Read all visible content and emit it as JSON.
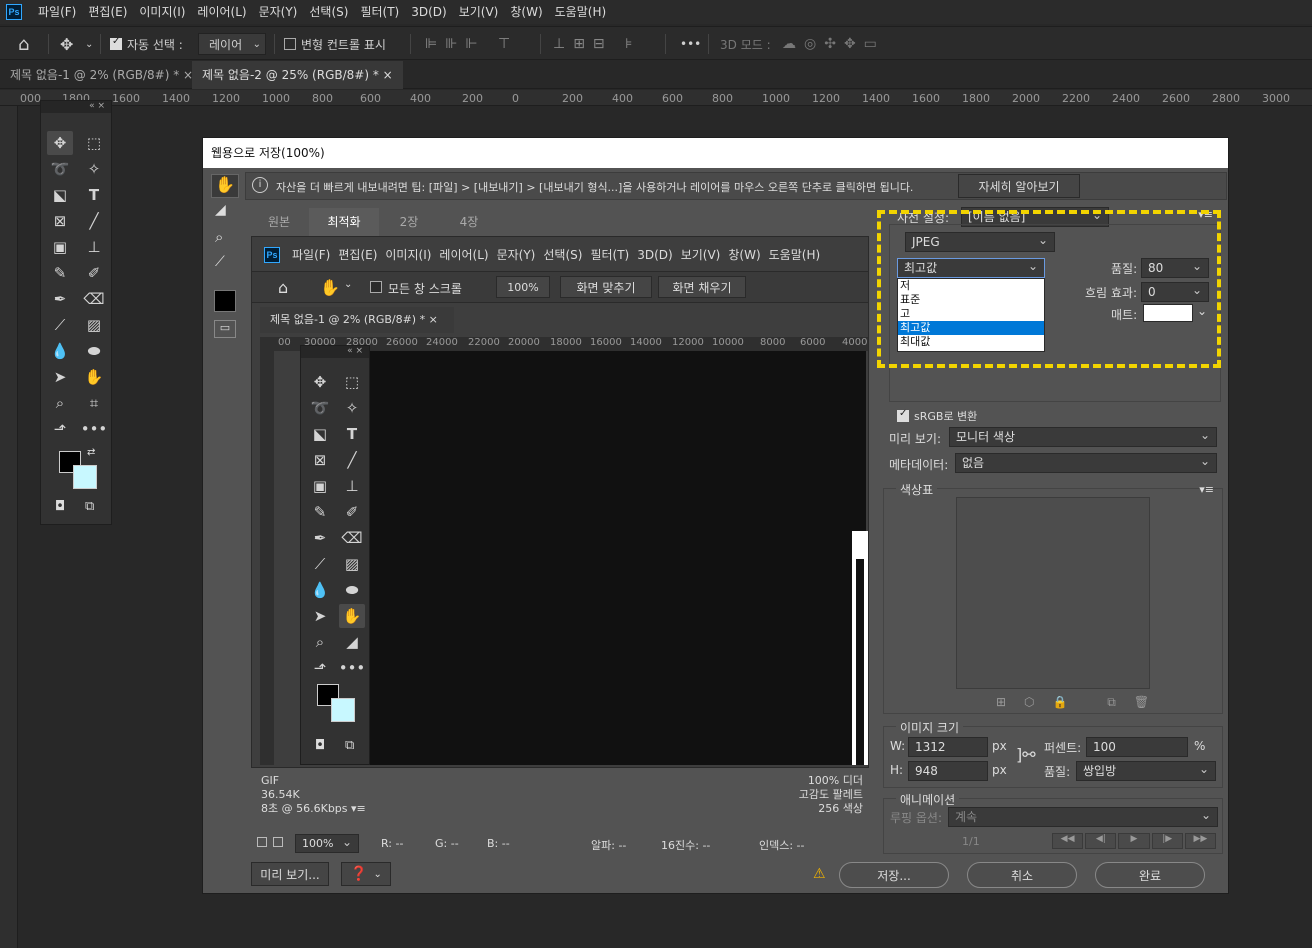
{
  "menubar": {
    "logo": "Ps",
    "items": [
      "파일(F)",
      "편집(E)",
      "이미지(I)",
      "레이어(L)",
      "문자(Y)",
      "선택(S)",
      "필터(T)",
      "3D(D)",
      "보기(V)",
      "창(W)",
      "도움말(H)"
    ]
  },
  "options": {
    "auto_select_label": "자동 선택 :",
    "auto_select_value": "레이어",
    "transform_label": "변형 컨트롤 표시",
    "mode_3d": "3D 모드 :",
    "more": "•••"
  },
  "doc_tabs": [
    {
      "label": "제목 없음-1 @ 2% (RGB/8#) *",
      "close": "×"
    },
    {
      "label": "제목 없음-2 @ 25% (RGB/8#) *",
      "close": "×"
    }
  ],
  "ruler_top": [
    "000",
    "1800",
    "1600",
    "1400",
    "1200",
    "1000",
    "800",
    "600",
    "400",
    "200",
    "0",
    "200",
    "400",
    "600",
    "800",
    "1000",
    "1200",
    "1400",
    "1600",
    "1800",
    "2000",
    "2200",
    "2400",
    "2600",
    "2800",
    "3000"
  ],
  "dialog": {
    "title": "웹용으로 저장(100%)",
    "tip": "자산을 더 빠르게 내보내려면 팁: [파일] > [내보내기] > [내보내기 형식...]을 사용하거나 레이어를 마우스 오른쪽 단추로 클릭하면 됩니다.",
    "learn_more": "자세히 알아보기",
    "view_tabs": [
      "원본",
      "최적화",
      "2장",
      "4장"
    ],
    "inner_menu": [
      "파일(F)",
      "편집(E)",
      "이미지(I)",
      "레이어(L)",
      "문자(Y)",
      "선택(S)",
      "필터(T)",
      "3D(D)",
      "보기(V)",
      "창(W)",
      "도움말(H)"
    ],
    "inner_options": {
      "scroll_all": "모든 창 스크롤",
      "zoom": "100%",
      "fit_screen": "화면 맞추기",
      "fill_screen": "화면 채우기"
    },
    "inner_tab": {
      "label": "제목 없음-1 @ 2% (RGB/8#) *",
      "close": "×"
    },
    "inner_ruler": [
      "00",
      "30000",
      "28000",
      "26000",
      "24000",
      "22000",
      "20000",
      "18000",
      "16000",
      "14000",
      "12000",
      "10000",
      "8000",
      "6000",
      "4000"
    ],
    "status_left": [
      "GIF",
      "36.54K",
      "8초 @ 56.6Kbps"
    ],
    "status_right": [
      "100% 디더",
      "고감도 팔레트",
      "256 색상"
    ],
    "bottom_bar": {
      "zoom": "100%",
      "r": "R: --",
      "g": "G: --",
      "b": "B: --",
      "alpha": "알파: --",
      "hex": "16진수: --",
      "index": "인덱스: --"
    },
    "preview_button": "미리 보기...",
    "save_button": "저장...",
    "cancel_button": "취소",
    "done_button": "완료",
    "settings": {
      "preset_label": "사전 설정:",
      "preset_value": "[이름 없음]",
      "format": "JPEG",
      "quality_preset": "최고값",
      "quality_options": [
        "저",
        "표준",
        "고",
        "최고값",
        "최대값"
      ],
      "quality_selected_index": 3,
      "quality_label": "품질:",
      "quality_value": "80",
      "blur_label": "흐림 효과:",
      "blur_value": "0",
      "matte_label": "매트:",
      "srgb_label": "sRGB로 변환",
      "preview_label": "미리 보기:",
      "preview_value": "모니터 색상",
      "metadata_label": "메타데이터:",
      "metadata_value": "없음",
      "color_table_label": "색상표",
      "image_size_label": "이미지 크기",
      "w_label": "W:",
      "w_value": "1312",
      "h_label": "H:",
      "h_value": "948",
      "px": "px",
      "percent_label": "퍼센트:",
      "percent_value": "100",
      "percent_unit": "%",
      "quality2_label": "품질:",
      "quality2_value": "쌍입방",
      "animation_label": "애니메이션",
      "loop_label": "루핑 옵션:",
      "loop_value": "계속",
      "frame": "1/1"
    }
  },
  "colors": {
    "highlight": "#f2d400",
    "selection": "#0078d7",
    "foreground": "#000000",
    "background": "#c8f8ff"
  }
}
